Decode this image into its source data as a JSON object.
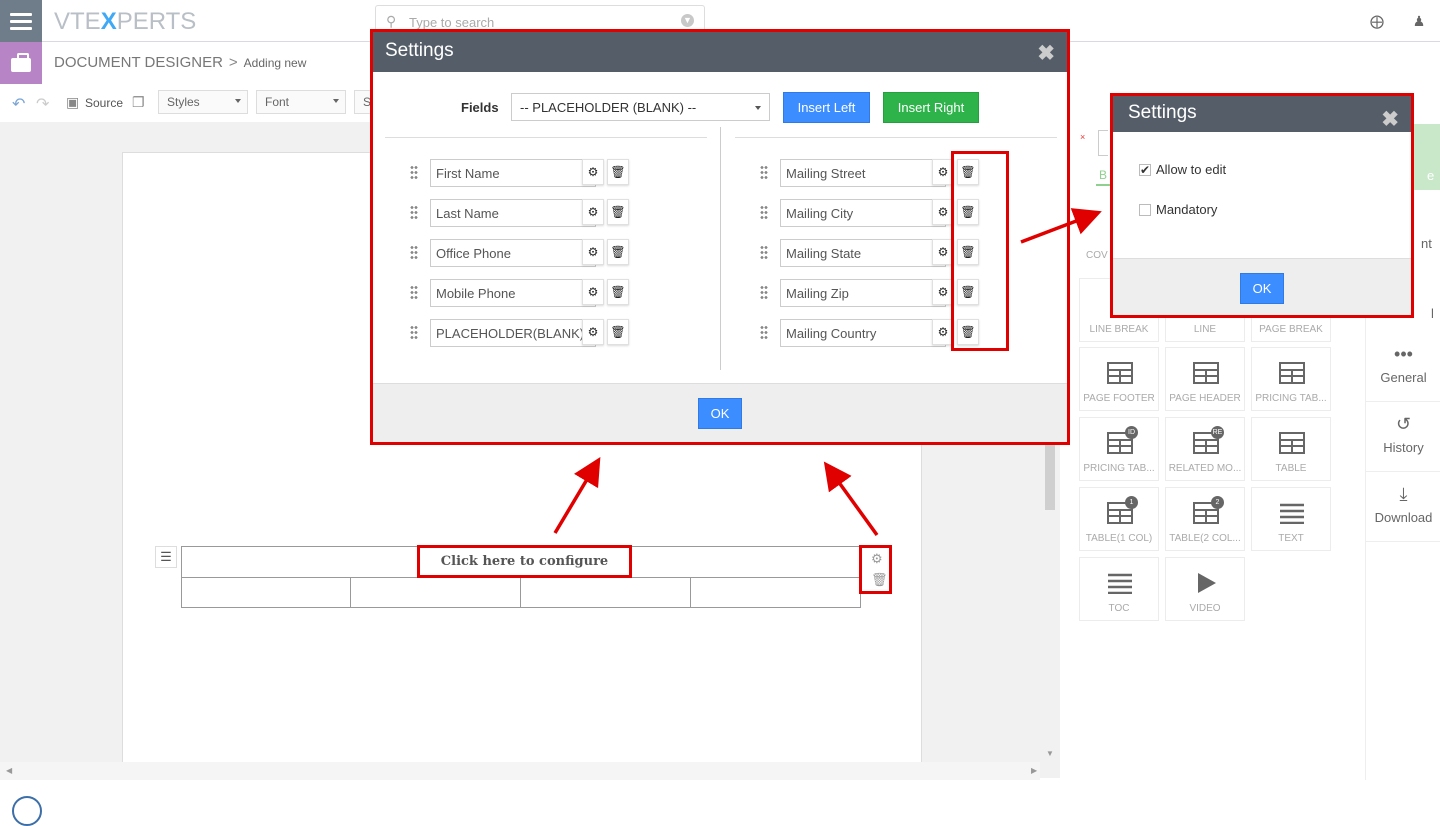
{
  "brand": {
    "logo_prefix": "VTE",
    "logo_x": "X",
    "logo_suffix": "PERTS"
  },
  "search": {
    "placeholder": "Type to search"
  },
  "breadcrumb": {
    "module": "DOCUMENT DESIGNER",
    "separator": ">",
    "page": "Adding new"
  },
  "toolbar": {
    "source_label": "Source",
    "styles_label": "Styles",
    "font_label": "Font",
    "size_label": "S"
  },
  "canvas": {
    "configure_label": "Click here to configure"
  },
  "settings_modal": {
    "title": "Settings",
    "close_glyph": "✖",
    "fields_label": "Fields",
    "fields_selected": "-- PLACEHOLDER (BLANK) --",
    "insert_left_label": "Insert Left",
    "insert_right_label": "Insert Right",
    "left_fields": [
      {
        "value": "First Name"
      },
      {
        "value": "Last Name"
      },
      {
        "value": "Office Phone"
      },
      {
        "value": "Mobile Phone"
      },
      {
        "value": "PLACEHOLDER(BLANK)"
      }
    ],
    "right_fields": [
      {
        "value": "Mailing Street"
      },
      {
        "value": "Mailing City"
      },
      {
        "value": "Mailing State"
      },
      {
        "value": "Mailing Zip"
      },
      {
        "value": "Mailing Country"
      }
    ],
    "ok_label": "OK"
  },
  "field_settings_modal": {
    "title": "Settings",
    "close_glyph": "✖",
    "allow_edit_label": "Allow to edit",
    "allow_edit_checked": true,
    "mandatory_label": "Mandatory",
    "mandatory_checked": false,
    "ok_label": "OK"
  },
  "palette": {
    "partial_tab_b": "B",
    "partial_tab_e": "e",
    "partial_nt": "nt",
    "partial_l": "l",
    "partial_cov": "COV",
    "tiles": [
      {
        "label": "LINE BREAK"
      },
      {
        "label": "LINE"
      },
      {
        "label": "PAGE BREAK"
      },
      {
        "label": "PAGE FOOTER"
      },
      {
        "label": "PAGE HEADER"
      },
      {
        "label": "PRICING TAB..."
      },
      {
        "label": "PRICING TAB...",
        "badge": "ID"
      },
      {
        "label": "RELATED MO...",
        "badge": "RE"
      },
      {
        "label": "TABLE"
      },
      {
        "label": "TABLE(1 COL)",
        "badge": "1"
      },
      {
        "label": "TABLE(2 COL...",
        "badge": "2"
      },
      {
        "label": "TEXT"
      },
      {
        "label": "TOC"
      },
      {
        "label": "VIDEO"
      }
    ]
  },
  "side_nav": [
    {
      "icon": "more-icon",
      "label": "General"
    },
    {
      "icon": "history-icon",
      "label": "History"
    },
    {
      "icon": "download-icon",
      "label": "Download"
    }
  ],
  "colors": {
    "accent_blue": "#3c8dff",
    "accent_green": "#2db34a",
    "highlight_red": "#e00000",
    "modal_header": "#555e68"
  }
}
